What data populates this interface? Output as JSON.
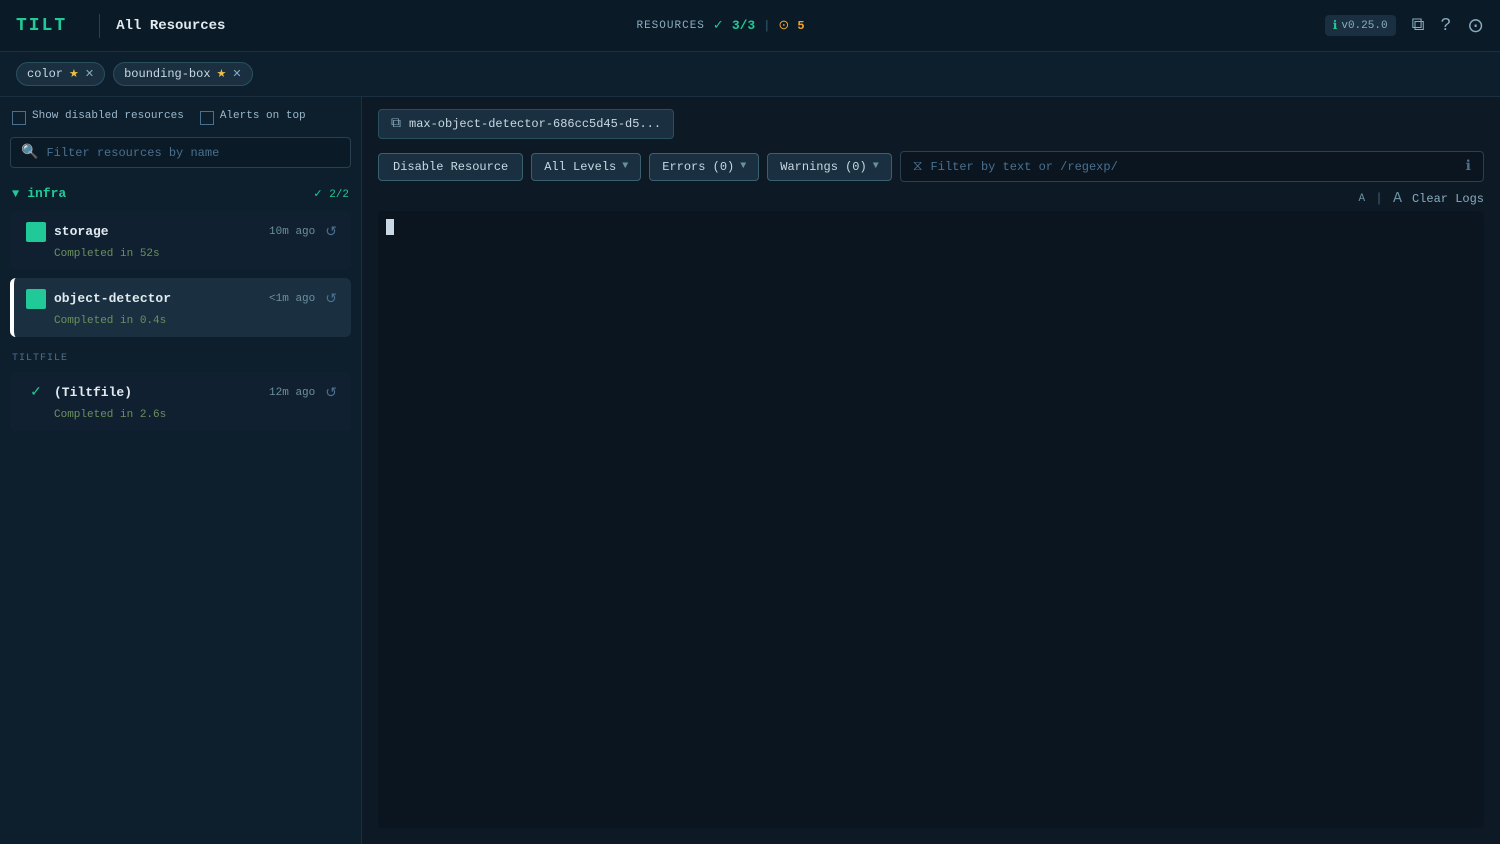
{
  "header": {
    "logo": "TILT",
    "title": "All Resources",
    "resources_label": "RESOURCES",
    "check_count": "3/3",
    "alert_count": "5",
    "version": "v0.25.0"
  },
  "tags_bar": {
    "tags": [
      {
        "label": "color",
        "star": true
      },
      {
        "label": "bounding-box",
        "star": true
      }
    ]
  },
  "sidebar": {
    "show_disabled_label": "Show disabled resources",
    "alerts_on_top_label": "Alerts on top",
    "search_placeholder": "Filter resources by name",
    "groups": [
      {
        "name": "infra",
        "count": "2/2",
        "resources": [
          {
            "name": "storage",
            "time": "10m ago",
            "status": "Completed in 52s",
            "selected": false
          },
          {
            "name": "object-detector",
            "time": "<1m ago",
            "status": "Completed in 0.4s",
            "selected": true
          }
        ]
      }
    ],
    "tiltfile_section_label": "TILTFILE",
    "tiltfile_resource": {
      "name": "(Tiltfile)",
      "time": "12m ago",
      "status": "Completed in 2.6s"
    }
  },
  "content": {
    "resource_selector_text": "max-object-detector-686cc5d45-d5...",
    "disable_btn": "Disable Resource",
    "levels_btn": "All Levels",
    "errors_btn": "Errors (0)",
    "warnings_btn": "Warnings (0)",
    "log_filter_placeholder": "Filter by text or /regexp/",
    "font_size_small": "A",
    "font_size_large": "A",
    "clear_logs_btn": "Clear Logs"
  },
  "colors": {
    "green": "#20c997",
    "bg_dark": "#0d1f2d",
    "accent": "#2a5060"
  }
}
